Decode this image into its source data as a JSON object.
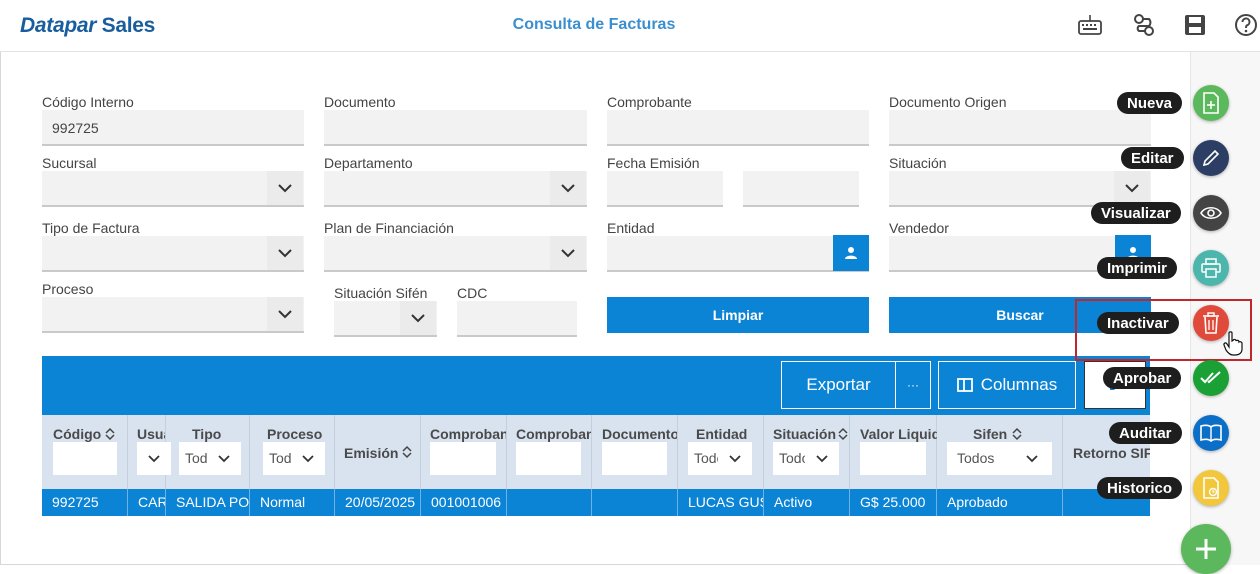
{
  "app": {
    "brand_part1": "Datapar ",
    "brand_part2": "Sales",
    "page_title": "Consulta de Facturas",
    "icons": [
      "keyboard-icon",
      "route-icon",
      "save-icon",
      "help-icon"
    ]
  },
  "form": {
    "codigo_interno": {
      "label": "Código Interno",
      "value": "992725"
    },
    "documento": {
      "label": "Documento",
      "value": ""
    },
    "comprobante": {
      "label": "Comprobante",
      "value": ""
    },
    "documento_origen": {
      "label": "Documento Origen",
      "value": ""
    },
    "sucursal": {
      "label": "Sucursal",
      "value": ""
    },
    "departamento": {
      "label": "Departamento",
      "value": ""
    },
    "fecha_emision": {
      "label": "Fecha Emisión",
      "from": "",
      "to": ""
    },
    "situacion": {
      "label": "Situación",
      "value": ""
    },
    "tipo_factura": {
      "label": "Tipo de Factura",
      "value": ""
    },
    "plan_financiacion": {
      "label": "Plan de Financiación",
      "value": ""
    },
    "entidad": {
      "label": "Entidad",
      "value": ""
    },
    "vendedor": {
      "label": "Vendedor",
      "value": ""
    },
    "proceso": {
      "label": "Proceso",
      "value": ""
    },
    "situacion_sifen": {
      "label": "Situación Sifén",
      "value": ""
    },
    "cdc": {
      "label": "CDC",
      "value": ""
    },
    "limpiar_label": "Limpiar",
    "buscar_label": "Buscar"
  },
  "grid": {
    "exportar_label": "Exportar",
    "more_label": "···",
    "columnas_label": "Columnas",
    "columns": [
      {
        "header": "Código",
        "filter": ""
      },
      {
        "header": "Usuario",
        "filter": ""
      },
      {
        "header": "Tipo",
        "filter": "Todos"
      },
      {
        "header": "Proceso",
        "filter": "Todos"
      },
      {
        "header": "Emisión",
        "filter": ""
      },
      {
        "header": "Comprobante",
        "filter": ""
      },
      {
        "header": "Comprobante",
        "filter": ""
      },
      {
        "header": "Documento",
        "filter": ""
      },
      {
        "header": "Entidad",
        "filter": "Todos"
      },
      {
        "header": "Situación",
        "filter": "Todos"
      },
      {
        "header": "Valor Liquido",
        "filter": ""
      },
      {
        "header": "Sifen",
        "filter": "Todos"
      },
      {
        "header": "Retorno SIFEN",
        "filter": ""
      }
    ],
    "rows": [
      [
        "992725",
        "CARLOS",
        "SALIDA POR",
        "Normal",
        "20/05/2025",
        "001001006",
        "",
        "",
        "LUCAS GUS",
        "Activo",
        "G$ 25.000",
        "Aprobado",
        ""
      ]
    ]
  },
  "actions": [
    {
      "label": "Nueva",
      "icon": "new-document-icon",
      "color": "#5cb85c"
    },
    {
      "label": "Editar",
      "icon": "pencil-icon",
      "color": "#2c3e63"
    },
    {
      "label": "Visualizar",
      "icon": "eye-icon",
      "color": "#444444"
    },
    {
      "label": "Imprimir",
      "icon": "printer-icon",
      "color": "#4db6ac"
    },
    {
      "label": "Inactivar",
      "icon": "trash-icon",
      "color": "#e04a3a"
    },
    {
      "label": "Aprobar",
      "icon": "double-check-icon",
      "color": "#1aa035"
    },
    {
      "label": "Auditar",
      "icon": "book-icon",
      "color": "#0b6fc7"
    },
    {
      "label": "Historico",
      "icon": "history-document-icon",
      "color": "#f2c73c"
    }
  ],
  "fab_main": {
    "icon": "plus-icon",
    "color": "#5cb85c"
  }
}
